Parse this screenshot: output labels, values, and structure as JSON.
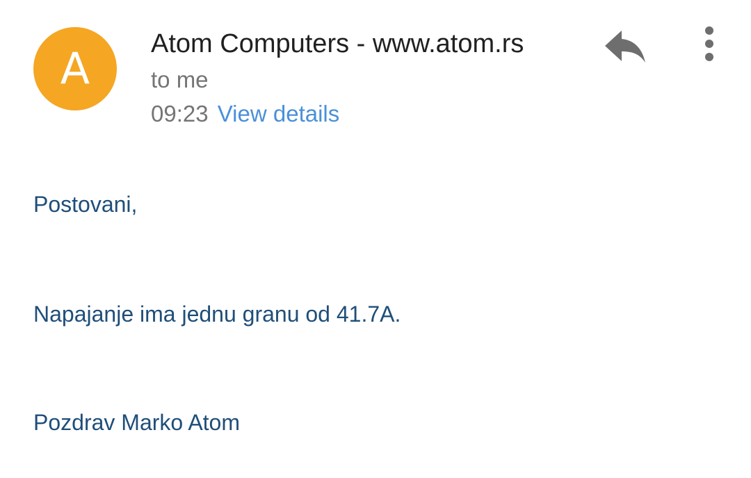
{
  "header": {
    "avatar_letter": "A",
    "avatar_color": "#F5A623",
    "sender": "Atom Computers - www.atom.rs",
    "recipient": "to me",
    "time": "09:23",
    "details_link": "View details",
    "reply_icon": "reply-icon",
    "more_icon": "more-vert-icon"
  },
  "body": {
    "greeting": "Postovani,",
    "message": "Napajanje ima jednu granu od 41.7A.",
    "signoff": "Pozdrav Marko Atom"
  },
  "colors": {
    "body_text": "#1F4E79",
    "link": "#4A90D9",
    "meta": "#757575"
  }
}
